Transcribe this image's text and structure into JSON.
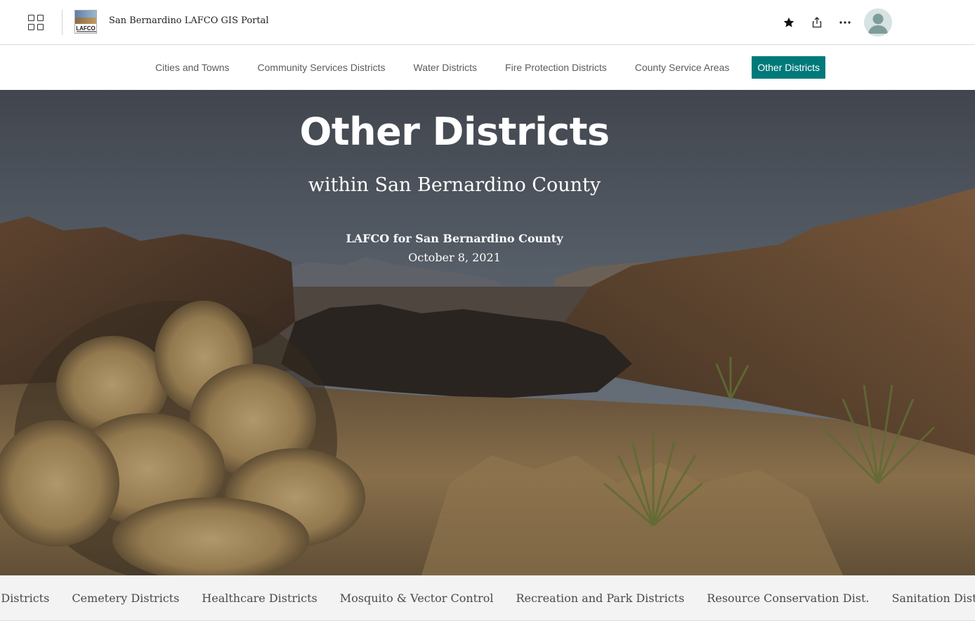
{
  "header": {
    "app_launcher_icon": "apps-grid-icon",
    "logo_text": "LAFCO",
    "portal_title": "San Bernardino LAFCO GIS Portal",
    "icons": [
      "star-icon",
      "share-icon",
      "more-icon",
      "user-avatar-icon"
    ]
  },
  "nav": {
    "items": [
      {
        "label": "Cities and Towns",
        "active": false
      },
      {
        "label": "Community Services Districts",
        "active": false
      },
      {
        "label": "Water Districts",
        "active": false
      },
      {
        "label": "Fire Protection Districts",
        "active": false
      },
      {
        "label": "County Service Areas",
        "active": false
      },
      {
        "label": "Other Districts",
        "active": true
      }
    ]
  },
  "hero": {
    "title": "Other Districts",
    "subtitle": "within San Bernardino County",
    "organization": "LAFCO for San Bernardino County",
    "date": "October 8, 2021"
  },
  "tabs_strip": {
    "items": [
      "Airport Districts",
      "Cemetery Districts",
      "Healthcare Districts",
      "Mosquito & Vector Control",
      "Recreation and Park Districts",
      "Resource Conservation Dist.",
      "Sanitation Districts"
    ]
  },
  "colors": {
    "accent": "#00797a",
    "nav_text": "#5c5c5c",
    "strip_bg": "#f3f3f3"
  }
}
